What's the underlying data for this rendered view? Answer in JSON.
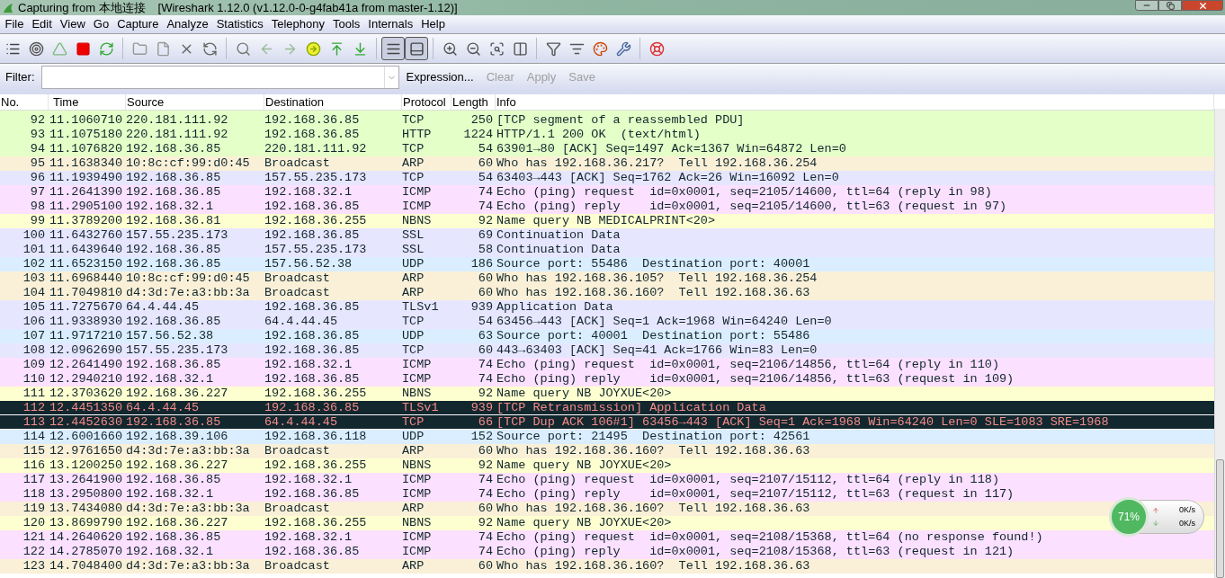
{
  "window": {
    "title": "Capturing from 本地连接",
    "subtitle": "[Wireshark 1.12.0  (v1.12.0-0-g4fab41a from master-1.12)]"
  },
  "menu": [
    "File",
    "Edit",
    "View",
    "Go",
    "Capture",
    "Analyze",
    "Statistics",
    "Telephony",
    "Tools",
    "Internals",
    "Help"
  ],
  "view_toggles": [
    {
      "pressed": true
    },
    {
      "pressed": true
    }
  ],
  "filter": {
    "label": "Filter:",
    "buttons": [
      {
        "label": "Expression...",
        "disabled": false
      },
      {
        "label": "Clear",
        "disabled": true
      },
      {
        "label": "Apply",
        "disabled": true
      },
      {
        "label": "Save",
        "disabled": true
      }
    ]
  },
  "table": {
    "columns": [
      "No.",
      "Time",
      "Source",
      "Destination",
      "Protocol",
      "Length",
      "Info"
    ],
    "rows": [
      {
        "cells": [
          "92",
          "11.1060710",
          "220.181.111.92",
          "192.168.36.85",
          "TCP",
          "250",
          "[TCP segment of a reassembled PDU]"
        ],
        "color": "#e4ffc7",
        "kind": "normal"
      },
      {
        "cells": [
          "93",
          "11.1075180",
          "220.181.111.92",
          "192.168.36.85",
          "HTTP",
          "1224",
          "HTTP/1.1 200 OK  (text/html)"
        ],
        "color": "#e4ffc7",
        "kind": "normal"
      },
      {
        "cells": [
          "94",
          "11.1076820",
          "192.168.36.85",
          "220.181.111.92",
          "TCP",
          "54",
          "63901→80 [ACK] Seq=1497 Ack=1367 Win=64872 Len=0"
        ],
        "color": "#e4ffc7",
        "kind": "normal"
      },
      {
        "cells": [
          "95",
          "11.1638340",
          "10:8c:cf:99:d0:45",
          "Broadcast",
          "ARP",
          "60",
          "Who has 192.168.36.217?  Tell 192.168.36.254"
        ],
        "color": "#faf0d7",
        "kind": "normal"
      },
      {
        "cells": [
          "96",
          "11.1939490",
          "192.168.36.85",
          "157.55.235.173",
          "TCP",
          "54",
          "63403→443 [ACK] Seq=1762 Ack=26 Win=16092 Len=0"
        ],
        "color": "#e7e6ff",
        "kind": "normal"
      },
      {
        "cells": [
          "97",
          "11.2641390",
          "192.168.36.85",
          "192.168.32.1",
          "ICMP",
          "74",
          "Echo (ping) request  id=0x0001, seq=2105/14600, ttl=64 (reply in 98)"
        ],
        "color": "#fce0ff",
        "kind": "normal"
      },
      {
        "cells": [
          "98",
          "11.2905100",
          "192.168.32.1",
          "192.168.36.85",
          "ICMP",
          "74",
          "Echo (ping) reply    id=0x0001, seq=2105/14600, ttl=63 (request in 97)"
        ],
        "color": "#fce0ff",
        "kind": "normal"
      },
      {
        "cells": [
          "99",
          "11.3789200",
          "192.168.36.81",
          "192.168.36.255",
          "NBNS",
          "92",
          "Name query NB MEDICALPRINT<20>"
        ],
        "color": "#feffd0",
        "kind": "normal"
      },
      {
        "cells": [
          "100",
          "11.6432760",
          "157.55.235.173",
          "192.168.36.85",
          "SSL",
          "69",
          "Continuation Data"
        ],
        "color": "#e7e6ff",
        "kind": "normal"
      },
      {
        "cells": [
          "101",
          "11.6439640",
          "192.168.36.85",
          "157.55.235.173",
          "SSL",
          "58",
          "Continuation Data"
        ],
        "color": "#e7e6ff",
        "kind": "normal"
      },
      {
        "cells": [
          "102",
          "11.6523150",
          "192.168.36.85",
          "157.56.52.38",
          "UDP",
          "186",
          "Source port: 55486  Destination port: 40001"
        ],
        "color": "#daeeff",
        "kind": "normal"
      },
      {
        "cells": [
          "103",
          "11.6968440",
          "10:8c:cf:99:d0:45",
          "Broadcast",
          "ARP",
          "60",
          "Who has 192.168.36.105?  Tell 192.168.36.254"
        ],
        "color": "#faf0d7",
        "kind": "normal"
      },
      {
        "cells": [
          "104",
          "11.7049810",
          "d4:3d:7e:a3:bb:3a",
          "Broadcast",
          "ARP",
          "60",
          "Who has 192.168.36.160?  Tell 192.168.36.63"
        ],
        "color": "#faf0d7",
        "kind": "normal"
      },
      {
        "cells": [
          "105",
          "11.7275670",
          "64.4.44.45",
          "192.168.36.85",
          "TLSv1",
          "939",
          "Application Data"
        ],
        "color": "#e7e6ff",
        "kind": "normal"
      },
      {
        "cells": [
          "106",
          "11.9338930",
          "192.168.36.85",
          "64.4.44.45",
          "TCP",
          "54",
          "63456→443 [ACK] Seq=1 Ack=1968 Win=64240 Len=0"
        ],
        "color": "#e7e6ff",
        "kind": "normal"
      },
      {
        "cells": [
          "107",
          "11.9717210",
          "157.56.52.38",
          "192.168.36.85",
          "UDP",
          "63",
          "Source port: 40001  Destination port: 55486"
        ],
        "color": "#daeeff",
        "kind": "normal"
      },
      {
        "cells": [
          "108",
          "12.0962690",
          "157.55.235.173",
          "192.168.36.85",
          "TCP",
          "60",
          "443→63403 [ACK] Seq=41 Ack=1766 Win=83 Len=0"
        ],
        "color": "#e7e6ff",
        "kind": "normal"
      },
      {
        "cells": [
          "109",
          "12.2641490",
          "192.168.36.85",
          "192.168.32.1",
          "ICMP",
          "74",
          "Echo (ping) request  id=0x0001, seq=2106/14856, ttl=64 (reply in 110)"
        ],
        "color": "#fce0ff",
        "kind": "normal"
      },
      {
        "cells": [
          "110",
          "12.2940210",
          "192.168.32.1",
          "192.168.36.85",
          "ICMP",
          "74",
          "Echo (ping) reply    id=0x0001, seq=2106/14856, ttl=63 (request in 109)"
        ],
        "color": "#fce0ff",
        "kind": "normal"
      },
      {
        "cells": [
          "111",
          "12.3703620",
          "192.168.36.227",
          "192.168.36.255",
          "NBNS",
          "92",
          "Name query NB JOYXUE<20>"
        ],
        "color": "#feffd0",
        "kind": "normal"
      },
      {
        "cells": [
          "112",
          "12.4451350",
          "64.4.44.45",
          "192.168.36.85",
          "TLSv1",
          "939",
          "[TCP Retransmission] Application Data"
        ],
        "color": "#12272e",
        "kind": "alert"
      },
      {
        "cells": [
          "113",
          "12.4452630",
          "192.168.36.85",
          "64.4.44.45",
          "TCP",
          "66",
          "[TCP Dup ACK 106#1] 63456→443 [ACK] Seq=1 Ack=1968 Win=64240 Len=0 SLE=1083 SRE=1968"
        ],
        "color": "#12272e",
        "kind": "alert"
      },
      {
        "cells": [
          "114",
          "12.6001660",
          "192.168.39.106",
          "192.168.36.118",
          "UDP",
          "152",
          "Source port: 21495  Destination port: 42561"
        ],
        "color": "#daeeff",
        "kind": "normal"
      },
      {
        "cells": [
          "115",
          "12.9761650",
          "d4:3d:7e:a3:bb:3a",
          "Broadcast",
          "ARP",
          "60",
          "Who has 192.168.36.160?  Tell 192.168.36.63"
        ],
        "color": "#faf0d7",
        "kind": "normal"
      },
      {
        "cells": [
          "116",
          "13.1200250",
          "192.168.36.227",
          "192.168.36.255",
          "NBNS",
          "92",
          "Name query NB JOYXUE<20>"
        ],
        "color": "#feffd0",
        "kind": "normal"
      },
      {
        "cells": [
          "117",
          "13.2641900",
          "192.168.36.85",
          "192.168.32.1",
          "ICMP",
          "74",
          "Echo (ping) request  id=0x0001, seq=2107/15112, ttl=64 (reply in 118)"
        ],
        "color": "#fce0ff",
        "kind": "normal"
      },
      {
        "cells": [
          "118",
          "13.2950800",
          "192.168.32.1",
          "192.168.36.85",
          "ICMP",
          "74",
          "Echo (ping) reply    id=0x0001, seq=2107/15112, ttl=63 (request in 117)"
        ],
        "color": "#fce0ff",
        "kind": "normal"
      },
      {
        "cells": [
          "119",
          "13.7434080",
          "d4:3d:7e:a3:bb:3a",
          "Broadcast",
          "ARP",
          "60",
          "Who has 192.168.36.160?  Tell 192.168.36.63"
        ],
        "color": "#faf0d7",
        "kind": "normal"
      },
      {
        "cells": [
          "120",
          "13.8699790",
          "192.168.36.227",
          "192.168.36.255",
          "NBNS",
          "92",
          "Name query NB JOYXUE<20>"
        ],
        "color": "#feffd0",
        "kind": "normal"
      },
      {
        "cells": [
          "121",
          "14.2640620",
          "192.168.36.85",
          "192.168.32.1",
          "ICMP",
          "74",
          "Echo (ping) request  id=0x0001, seq=2108/15368, ttl=64 (no response found!)"
        ],
        "color": "#fce0ff",
        "kind": "normal"
      },
      {
        "cells": [
          "122",
          "14.2785070",
          "192.168.32.1",
          "192.168.36.85",
          "ICMP",
          "74",
          "Echo (ping) reply    id=0x0001, seq=2108/15368, ttl=63 (request in 121)"
        ],
        "color": "#fce0ff",
        "kind": "normal"
      },
      {
        "cells": [
          "123",
          "14.7048400",
          "d4:3d:7e:a3:bb:3a",
          "Broadcast",
          "ARP",
          "60",
          "Who has 192.168.36.160?  Tell 192.168.36.63"
        ],
        "color": "#faf0d7",
        "kind": "normal"
      }
    ]
  },
  "net_monitor": {
    "percent": "71%",
    "upload": "0K/s",
    "download": "0K/s"
  }
}
